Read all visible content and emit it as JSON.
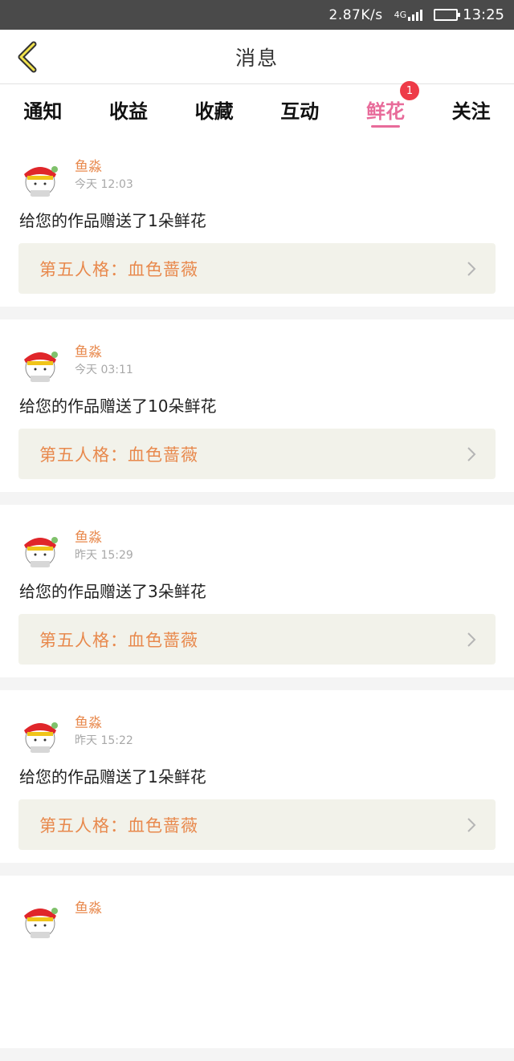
{
  "status_bar": {
    "speed": "2.87K/s",
    "network": "4G",
    "time": "13:25",
    "battery_level": 0.8
  },
  "header": {
    "title": "消息"
  },
  "tabs": [
    {
      "label": "通知"
    },
    {
      "label": "收益"
    },
    {
      "label": "收藏"
    },
    {
      "label": "互动"
    },
    {
      "label": "鲜花",
      "badge": "1"
    },
    {
      "label": "关注"
    }
  ],
  "colors": {
    "accent_pink": "#e86b9a",
    "accent_orange": "#e8894d",
    "badge_red": "#ee3b48"
  },
  "messages": [
    {
      "user": "鱼淼",
      "time": "今天 12:03",
      "text": "给您的作品赠送了1朵鲜花",
      "work_title": "第五人格：血色蔷薇"
    },
    {
      "user": "鱼淼",
      "time": "今天 03:11",
      "text": "给您的作品赠送了10朵鲜花",
      "work_title": "第五人格：血色蔷薇"
    },
    {
      "user": "鱼淼",
      "time": "昨天 15:29",
      "text": "给您的作品赠送了3朵鲜花",
      "work_title": "第五人格：血色蔷薇"
    },
    {
      "user": "鱼淼",
      "time": "昨天 15:22",
      "text": "给您的作品赠送了1朵鲜花",
      "work_title": "第五人格：血色蔷薇"
    },
    {
      "user": "鱼淼"
    }
  ]
}
